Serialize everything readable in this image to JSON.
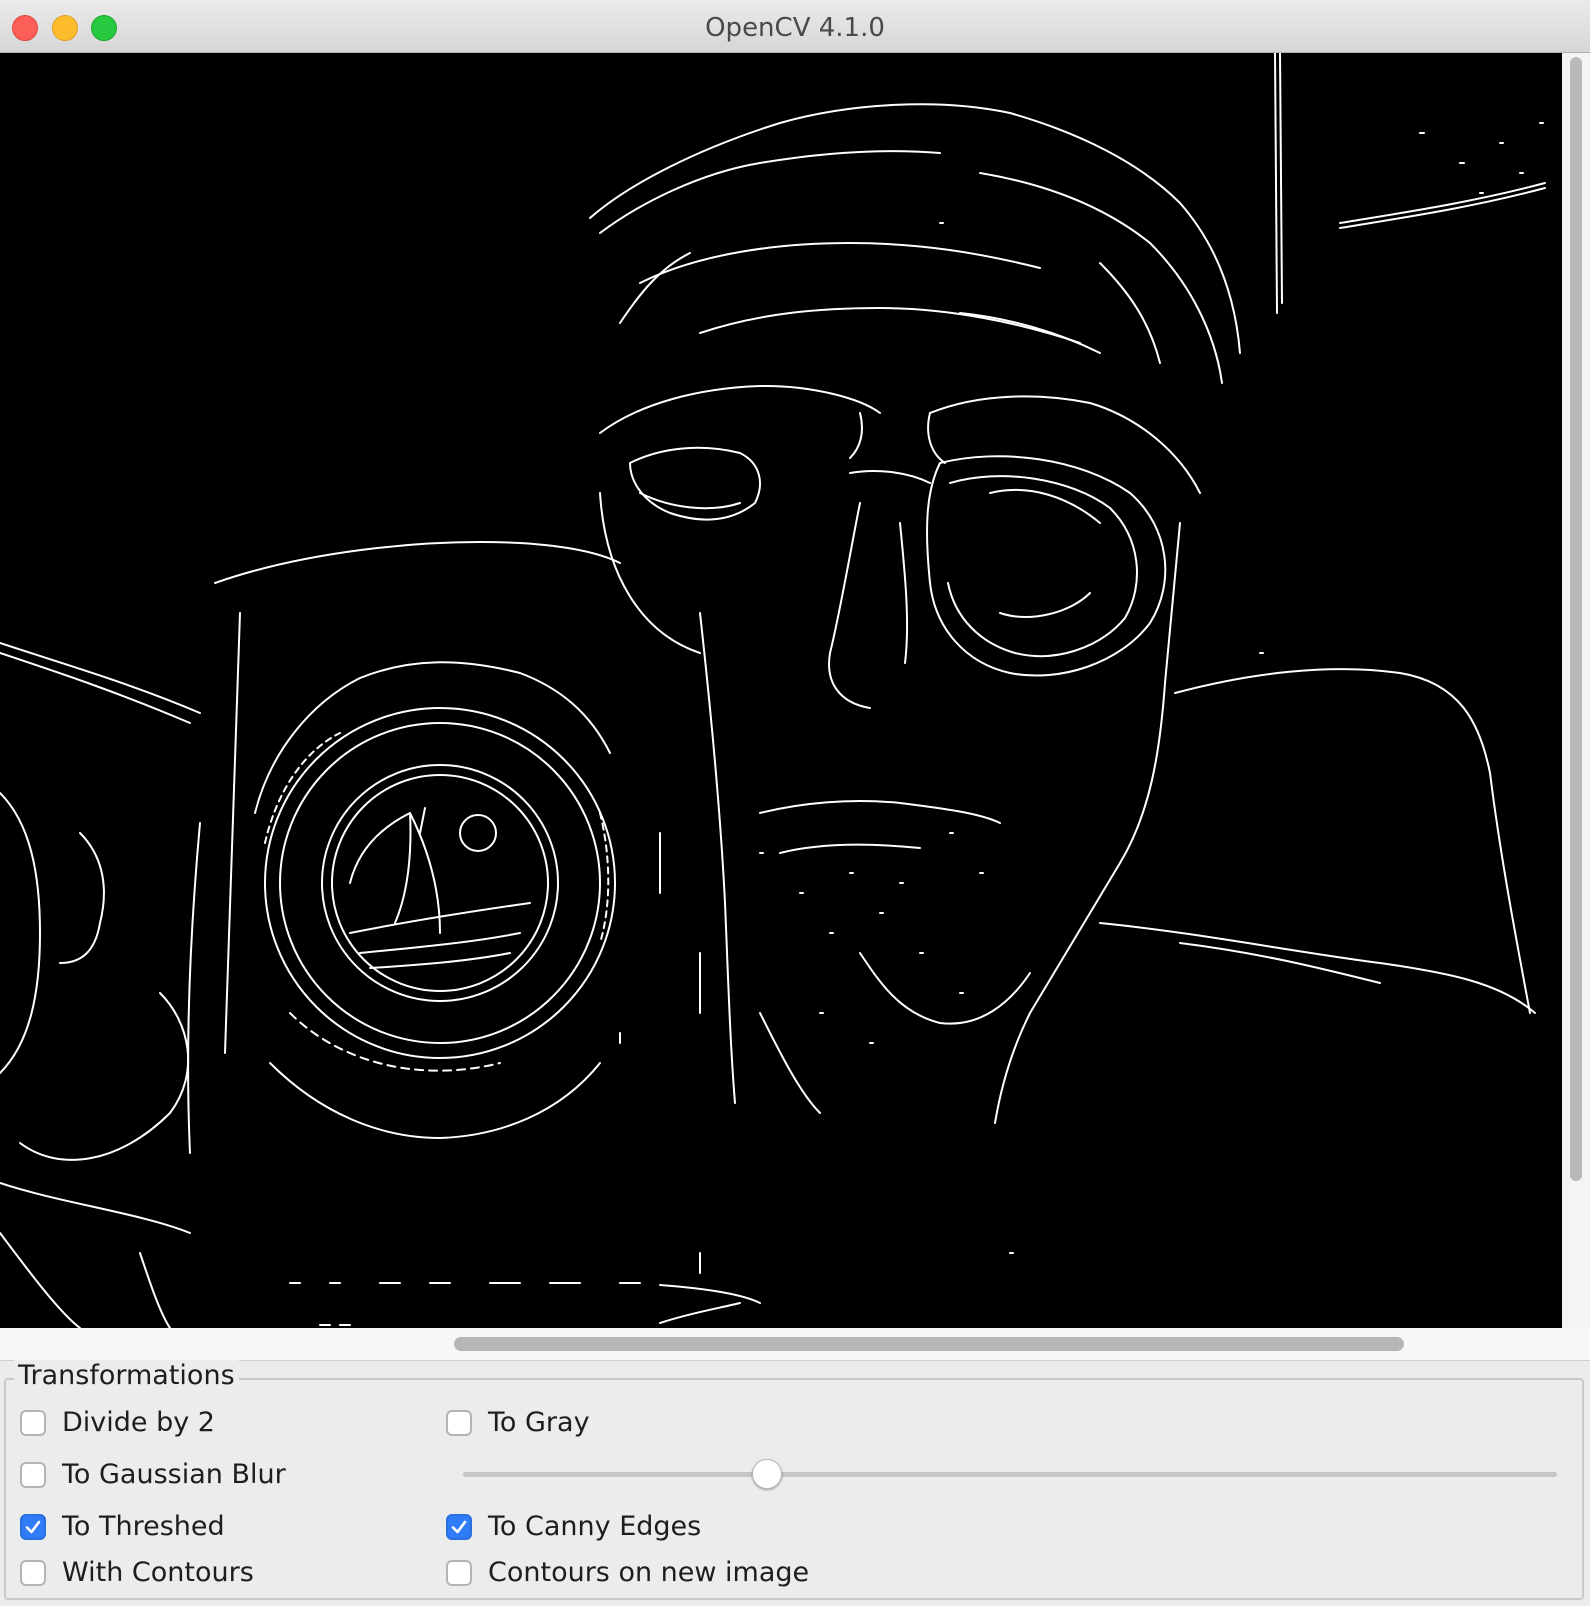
{
  "window": {
    "title": "OpenCV 4.1.0"
  },
  "viewport": {
    "description_icon": "canny-edges-image"
  },
  "panel": {
    "title": "Transformations",
    "checkboxes": [
      {
        "label": "Divide by 2",
        "checked": false
      },
      {
        "label": "To Gray",
        "checked": false
      },
      {
        "label": "To Gaussian Blur",
        "checked": false
      },
      {
        "label": "To Threshed",
        "checked": true
      },
      {
        "label": "To Canny Edges",
        "checked": true
      },
      {
        "label": "With Contours",
        "checked": false
      },
      {
        "label": "Contours on new image",
        "checked": false
      }
    ],
    "slider": {
      "value_fraction": 0.28
    }
  },
  "colors": {
    "accent": "#2f7cf6",
    "close": "#fc5f57",
    "minimize": "#fdbc2e",
    "maximize": "#28c840",
    "image_bg": "#000000",
    "edges": "#ffffff"
  }
}
